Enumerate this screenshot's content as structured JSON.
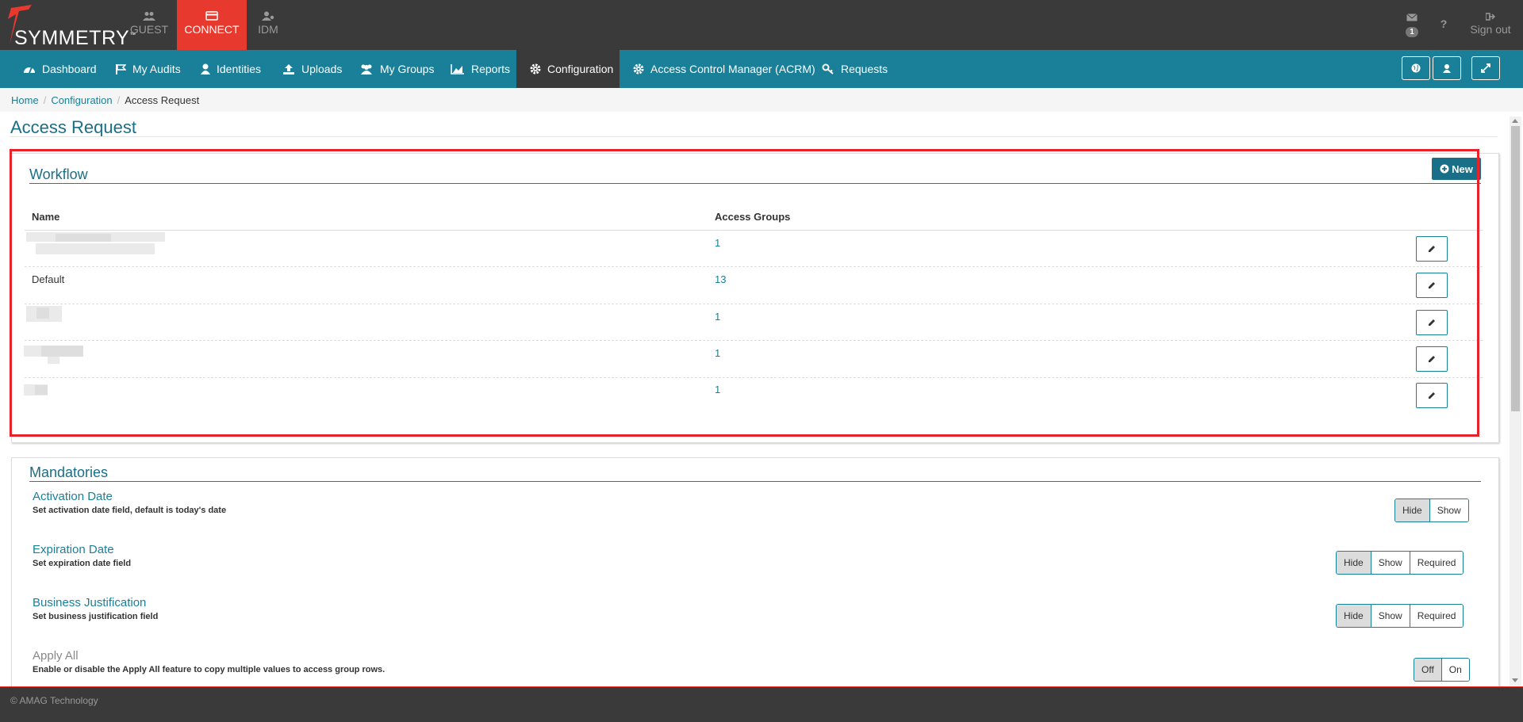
{
  "app": {
    "brand": "SYMMETRY",
    "tm": "™",
    "tabs": [
      {
        "label": "GUEST",
        "icon": "users-icon"
      },
      {
        "label": "CONNECT",
        "icon": "card-icon"
      },
      {
        "label": "IDM",
        "icon": "user-icon"
      }
    ],
    "notifications_count": "1",
    "help_label": "?",
    "sign_out_label": "Sign out"
  },
  "nav": {
    "items": [
      {
        "label": "Dashboard",
        "icon": "dashboard-icon"
      },
      {
        "label": "My Audits",
        "icon": "flag-icon"
      },
      {
        "label": "Identities",
        "icon": "user-icon"
      },
      {
        "label": "Uploads",
        "icon": "upload-icon"
      },
      {
        "label": "My Groups",
        "icon": "group-icon"
      },
      {
        "label": "Reports",
        "icon": "chart-icon"
      },
      {
        "label": "Configuration",
        "icon": "gear-icon"
      },
      {
        "label": "Access Control Manager (ACRM)",
        "icon": "gear-icon"
      },
      {
        "label": "Requests",
        "icon": "key-icon"
      }
    ]
  },
  "breadcrumb": [
    "Home",
    "Configuration",
    "Access Request"
  ],
  "page_title": "Access Request",
  "workflow": {
    "heading": "Workflow",
    "new_label": "New",
    "columns": [
      "Name",
      "Access Groups"
    ],
    "rows": [
      {
        "name": "",
        "count": "1"
      },
      {
        "name": "Default",
        "count": "13"
      },
      {
        "name": "",
        "count": "1"
      },
      {
        "name": "",
        "count": "1"
      },
      {
        "name": "",
        "count": "1"
      }
    ]
  },
  "mandatories": {
    "heading": "Mandatories",
    "items": [
      {
        "title": "Activation Date",
        "desc": "Set activation date field, default is today's date",
        "options": [
          "Hide",
          "Show"
        ],
        "selected": "Hide"
      },
      {
        "title": "Expiration Date",
        "desc": "Set expiration date field",
        "options": [
          "Hide",
          "Show",
          "Required"
        ],
        "selected": "Hide"
      },
      {
        "title": "Business Justification",
        "desc": "Set business justification field",
        "options": [
          "Hide",
          "Show",
          "Required"
        ],
        "selected": "Hide"
      },
      {
        "title": "Apply All",
        "desc": "Enable or disable the Apply All feature to copy multiple values to access group rows.",
        "options": [
          "Off",
          "On"
        ],
        "selected": "Off"
      }
    ]
  },
  "footer": "© AMAG Technology",
  "colors": {
    "accent": "#1a7f99",
    "brand_red": "#e8392e",
    "dark": "#3a3a3a",
    "highlight": "#e8222a"
  }
}
